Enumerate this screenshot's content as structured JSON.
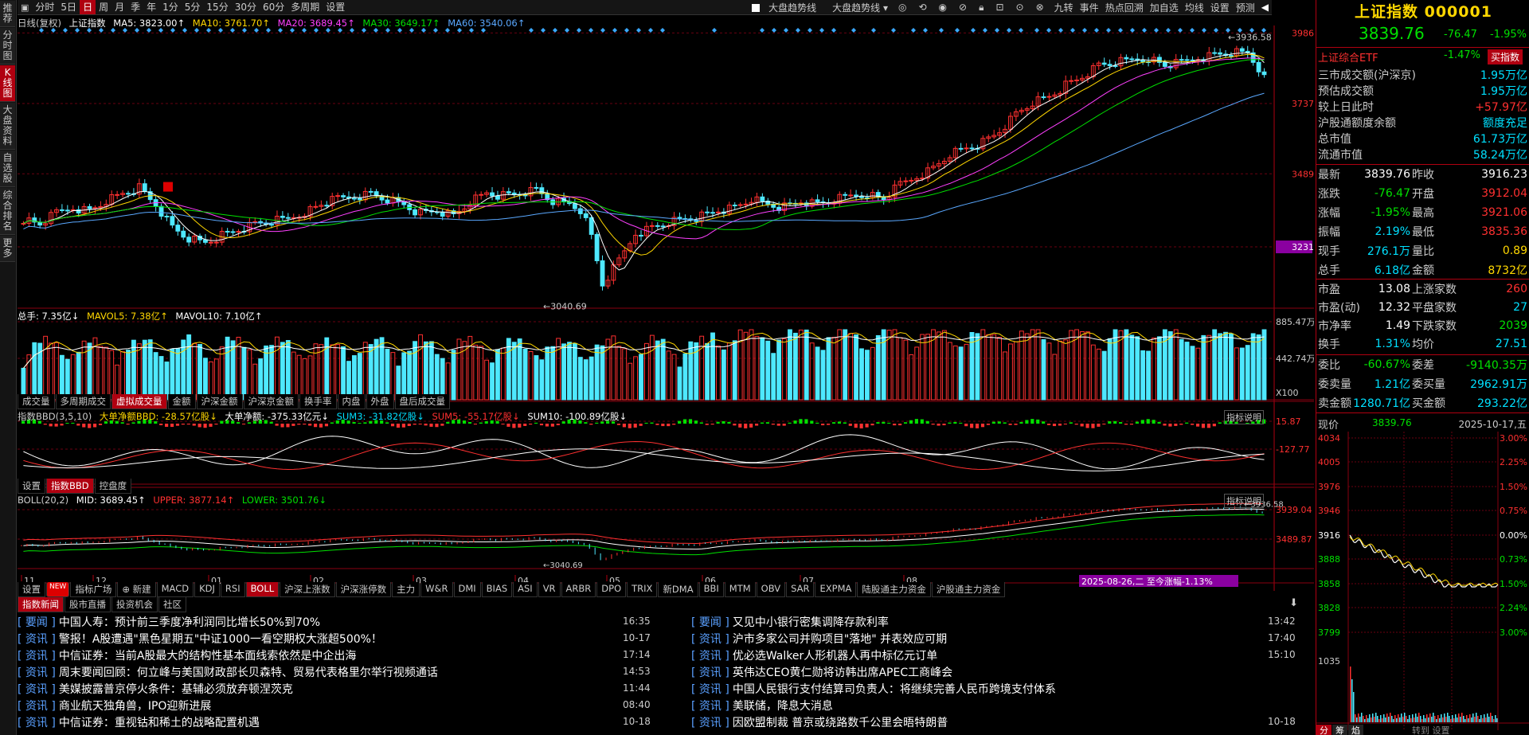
{
  "side_nav": [
    "推荐",
    "分时图",
    "K线图",
    "大盘资料",
    "自选股",
    "综合排名",
    "更多"
  ],
  "side_active": 2,
  "top_periods": [
    "分时",
    "5日",
    "日",
    "周",
    "月",
    "季",
    "年",
    "1分",
    "5分",
    "15分",
    "30分",
    "60分",
    "多周期",
    "设置"
  ],
  "top_active": 2,
  "top_right": [
    "大盘趋势线",
    "大盘趋势线 ▾",
    "九转",
    "事件",
    "热点回溯",
    "加自选",
    "均线",
    "设置",
    "预测"
  ],
  "kline_header": {
    "label": "日线(复权)",
    "name": "上证指数",
    "ma5": "MA5: 3823.00↑",
    "ma10": "MA10: 3761.70↑",
    "ma20": "MA20: 3689.45↑",
    "ma30": "MA30: 3649.17↑",
    "ma60": "MA60: 3540.06↑"
  },
  "kline_axis": [
    "3986",
    "3737",
    "3489",
    "3231"
  ],
  "kline_annotations": {
    "high": "3936.58",
    "low": "3040.69"
  },
  "volume_header": {
    "total": "总手: 7.35亿↓",
    "mavol5": "MAVOL5: 7.38亿↑",
    "mavol10": "MAVOL10: 7.10亿↑"
  },
  "volume_axis": [
    "885.47万",
    "442.74万",
    "X100"
  ],
  "volume_tabs": [
    "成交量",
    "多周期成交",
    "虚拟成交量",
    "金额",
    "沪深金额",
    "沪深京金额",
    "换手率",
    "内盘",
    "外盘",
    "盘后成交量"
  ],
  "volume_tab_active": 2,
  "bbd_header": {
    "title": "指数BBD(3,5,10)",
    "big": "大单净额BBD: -28.57亿股↓",
    "big2": "大单净额: -375.33亿元↓",
    "sum3": "SUM3: -31.82亿股↓",
    "sum5": "SUM5: -55.17亿股↓",
    "sum10": "SUM10: -100.89亿股↓",
    "help": "指标说明"
  },
  "bbd_axis": [
    "15.87",
    "-127.77"
  ],
  "bbd_tabs": [
    "设置",
    "指数BBD",
    "控盘度"
  ],
  "bbd_tab_active": 1,
  "boll_header": {
    "title": "BOLL(20,2)",
    "mid": "MID: 3689.45↑",
    "upper": "UPPER: 3877.14↑",
    "lower": "LOWER: 3501.76↓",
    "help": "指标说明"
  },
  "boll_axis": [
    "3939.04",
    "3489.87"
  ],
  "boll_annotations": {
    "high": "3936.58",
    "low": "3040.69"
  },
  "months": [
    "11",
    "12",
    "01",
    "02",
    "03",
    "04",
    "05",
    "06",
    "07",
    "08",
    "10"
  ],
  "date_badge": "2025-08-26,二 至今涨幅-1.13%",
  "indicator_tabs": [
    "设置",
    "NEW",
    "指标广场",
    "⊕ 新建",
    "MACD",
    "KDJ",
    "RSI",
    "BOLL",
    "沪深上涨数",
    "沪深涨停数",
    "主力",
    "W&R",
    "DMI",
    "BIAS",
    "ASI",
    "VR",
    "ARBR",
    "DPO",
    "TRIX",
    "新DMA",
    "BBI",
    "MTM",
    "OBV",
    "SAR",
    "EXPMA",
    "陆股通主力资金",
    "沪股通主力资金"
  ],
  "indicator_active": 7,
  "news_tabs": [
    "指数新闻",
    "股市直播",
    "投资机会",
    "社区"
  ],
  "news_left": [
    {
      "tag": "[ 要闻 ]",
      "title": "中国人寿：预计前三季度净利润同比增长50%到70%",
      "time": "16:35"
    },
    {
      "tag": "[ 资讯 ]",
      "title": "警报！A股遭遇\"黑色星期五\"中证1000一看空期权大涨超500%！",
      "time": "10-17"
    },
    {
      "tag": "[ 资讯 ]",
      "title": "中信证券：当前A股最大的结构性基本面线索依然是中企出海",
      "time": "17:14"
    },
    {
      "tag": "[ 资讯 ]",
      "title": "周末要闻回顾：何立峰与美国财政部长贝森特、贸易代表格里尔举行视频通话",
      "time": "14:53"
    },
    {
      "tag": "[ 资讯 ]",
      "title": "美媒披露普京停火条件：基辅必须放弃顿涅茨克",
      "time": "11:44"
    },
    {
      "tag": "[ 资讯 ]",
      "title": "商业航天独角兽，IPO迎新进展",
      "time": "08:40"
    },
    {
      "tag": "[ 资讯 ]",
      "title": "中信证券：重视钴和稀土的战略配置机遇",
      "time": "10-18"
    }
  ],
  "news_right": [
    {
      "tag": "[ 要闻 ]",
      "title": "又见中小银行密集调降存款利率",
      "time": "13:42"
    },
    {
      "tag": "[ 资讯 ]",
      "title": "沪市多家公司并购项目\"落地\" 并表效应可期",
      "time": "17:40"
    },
    {
      "tag": "[ 资讯 ]",
      "title": "优必选Walker人形机器人再中标亿元订单",
      "time": "15:10"
    },
    {
      "tag": "[ 资讯 ]",
      "title": "英伟达CEO黄仁勋将访韩出席APEC工商峰会",
      "time": ""
    },
    {
      "tag": "[ 资讯 ]",
      "title": "中国人民银行支付结算司负责人：将继续完善人民币跨境支付体系",
      "time": ""
    },
    {
      "tag": "[ 资讯 ]",
      "title": "美联储，降息大消息",
      "time": ""
    },
    {
      "tag": "[ 资讯 ]",
      "title": "因欧盟制裁 普京或绕路数千公里会晤特朗普",
      "time": "10-18"
    }
  ],
  "quote": {
    "title": "上证指数 000001",
    "price": "3839.76",
    "change": "-76.47",
    "pct": "-1.95%",
    "etf": "上证综合ETF",
    "etf_pct": "-1.47%",
    "buy": "买指数",
    "stats1": [
      [
        "三市成交额(沪深京)",
        "1.95万亿"
      ],
      [
        "预估成交额",
        "1.95万亿"
      ],
      [
        "较上日此时",
        "+57.97亿"
      ],
      [
        "沪股通额度余额",
        "额度充足"
      ],
      [
        "总市值",
        "61.73万亿"
      ],
      [
        "流通市值",
        "58.24万亿"
      ]
    ],
    "stats2": [
      [
        "最新",
        "3839.76",
        "昨收",
        "3916.23"
      ],
      [
        "涨跌",
        "-76.47",
        "开盘",
        "3912.04"
      ],
      [
        "涨幅",
        "-1.95%",
        "最高",
        "3921.06"
      ],
      [
        "振幅",
        "2.19%",
        "最低",
        "3835.36"
      ],
      [
        "现手",
        "276.1万",
        "量比",
        "0.89"
      ],
      [
        "总手",
        "6.18亿",
        "金额",
        "8732亿"
      ]
    ],
    "stats3": [
      [
        "市盈",
        "13.08",
        "上涨家数",
        "260"
      ],
      [
        "市盈(动)",
        "12.32",
        "平盘家数",
        "27"
      ],
      [
        "市净率",
        "1.49",
        "下跌家数",
        "2039"
      ],
      [
        "换手",
        "1.31%",
        "均价",
        "27.51"
      ]
    ],
    "stats4": [
      [
        "委比",
        "-60.67%",
        "委差",
        "-9140.35万"
      ],
      [
        "委卖量",
        "1.21亿",
        "委买量",
        "2962.91万"
      ],
      [
        "卖金额",
        "1280.71亿",
        "买金额",
        "293.22亿"
      ]
    ],
    "mini_label": "现价",
    "mini_price": "3839.76",
    "mini_date": "2025-10-17,五",
    "mini_left_axis": [
      "4034",
      "4005",
      "3976",
      "3946",
      "3916",
      "3888",
      "3858",
      "3828",
      "3799",
      "1035"
    ],
    "mini_right_axis": [
      "3.00%",
      "2.25%",
      "1.50%",
      "0.75%",
      "0.00%",
      "0.73%",
      "1.50%",
      "2.24%",
      "3.00%"
    ],
    "bottom_tabs": [
      "分",
      "筹",
      "焰"
    ],
    "bottom_note": "转到 设置"
  },
  "chart_data": {
    "type": "candlestick",
    "kline_close": [
      3330,
      3310,
      3350,
      3370,
      3360,
      3395,
      3420,
      3440,
      3380,
      3300,
      3260,
      3245,
      3270,
      3290,
      3310,
      3320,
      3330,
      3355,
      3380,
      3400,
      3410,
      3420,
      3400,
      3380,
      3350,
      3360,
      3340,
      3390,
      3420,
      3410,
      3420,
      3430,
      3390,
      3380,
      3350,
      3095,
      3180,
      3280,
      3300,
      3320,
      3330,
      3340,
      3360,
      3370,
      3400,
      3380,
      3370,
      3390,
      3380,
      3395,
      3410,
      3420,
      3400,
      3450,
      3480,
      3510,
      3560,
      3580,
      3600,
      3640,
      3700,
      3740,
      3760,
      3800,
      3830,
      3870,
      3880,
      3890,
      3900,
      3870,
      3880,
      3900,
      3910,
      3920,
      3916,
      3839
    ],
    "months": [
      "11",
      "12",
      "01",
      "02",
      "03",
      "04",
      "05",
      "06",
      "07",
      "08",
      "10"
    ]
  }
}
